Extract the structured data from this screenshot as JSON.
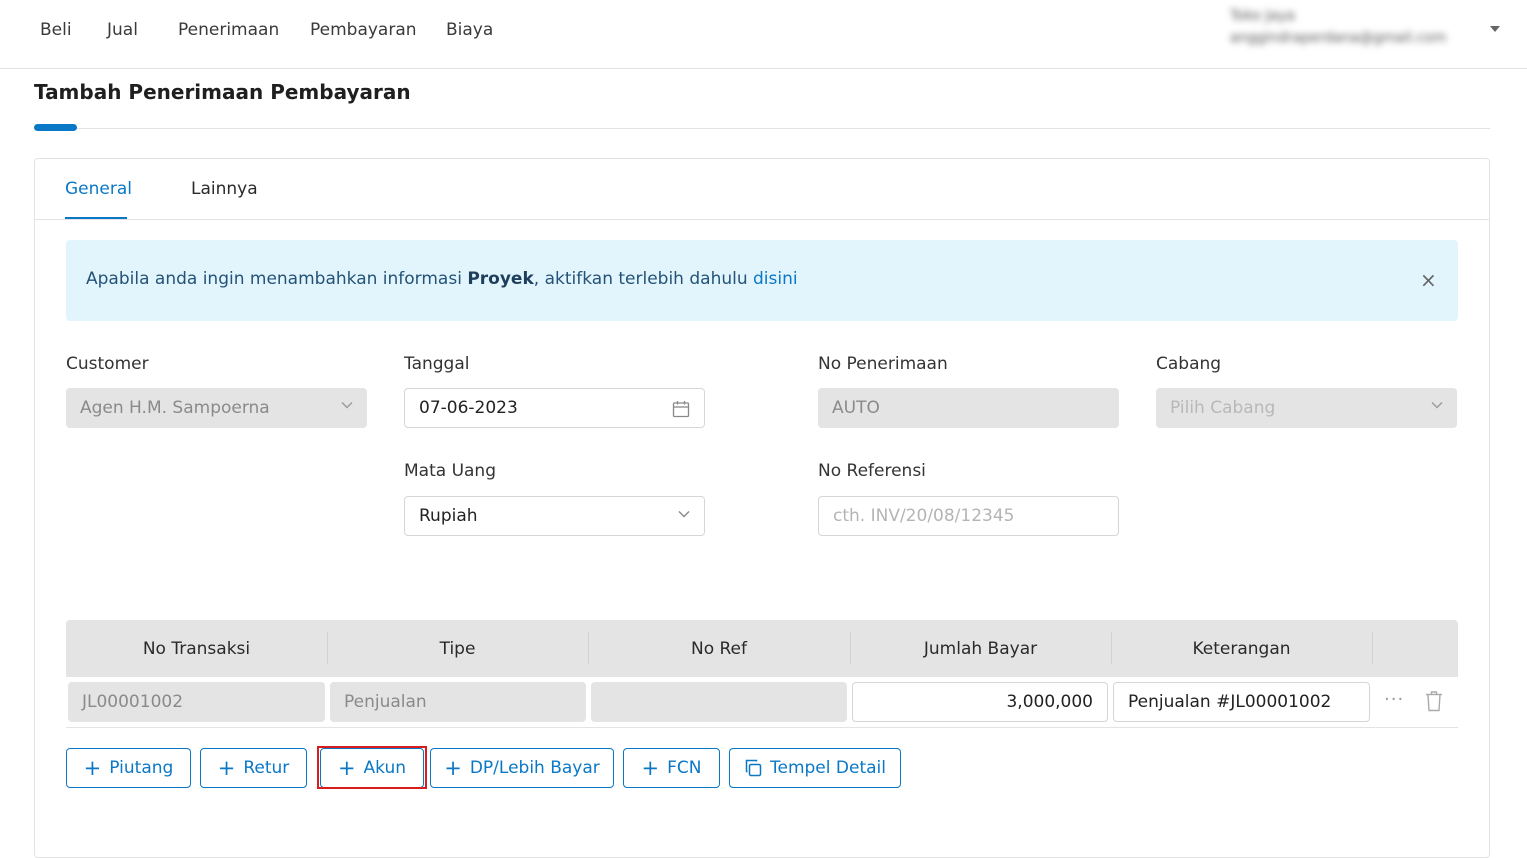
{
  "nav": {
    "items": [
      "Beli",
      "Jual",
      "Penerimaan",
      "Pembayaran",
      "Biaya"
    ],
    "user_name": "Toko Jaya",
    "user_email": "anggindraperdana@gmail.com"
  },
  "page": {
    "title": "Tambah Penerimaan Pembayaran"
  },
  "tabs": {
    "general": "General",
    "lainnya": "Lainnya"
  },
  "banner": {
    "text_before": "Apabila anda ingin menambahkan informasi ",
    "bold": "Proyek",
    "text_after": ", aktifkan terlebih dahulu ",
    "link": "disini",
    "close": "×"
  },
  "form": {
    "customer_label": "Customer",
    "customer_value": "Agen H.M. Sampoerna",
    "tanggal_label": "Tanggal",
    "tanggal_value": "07-06-2023",
    "no_penerimaan_label": "No Penerimaan",
    "no_penerimaan_value": "AUTO",
    "cabang_label": "Cabang",
    "cabang_placeholder": "Pilih Cabang",
    "mata_uang_label": "Mata Uang",
    "mata_uang_value": "Rupiah",
    "no_referensi_label": "No Referensi",
    "no_referensi_placeholder": "cth. INV/20/08/12345"
  },
  "table": {
    "headers": [
      "No Transaksi",
      "Tipe",
      "No Ref",
      "Jumlah Bayar",
      "Keterangan"
    ],
    "rows": [
      {
        "no_transaksi": "JL00001002",
        "tipe": "Penjualan",
        "no_ref": "",
        "jumlah_bayar": "3,000,000",
        "keterangan": "Penjualan #JL00001002"
      }
    ],
    "more": "···"
  },
  "buttons": {
    "piutang": "Piutang",
    "retur": "Retur",
    "akun": "Akun",
    "dp": "DP/Lebih Bayar",
    "fcn": "FCN",
    "tempel": "Tempel Detail",
    "plus": "+"
  },
  "colors": {
    "accent": "#0a78c6",
    "banner_bg": "#e2f5fd",
    "highlight": "#d91c1c"
  }
}
